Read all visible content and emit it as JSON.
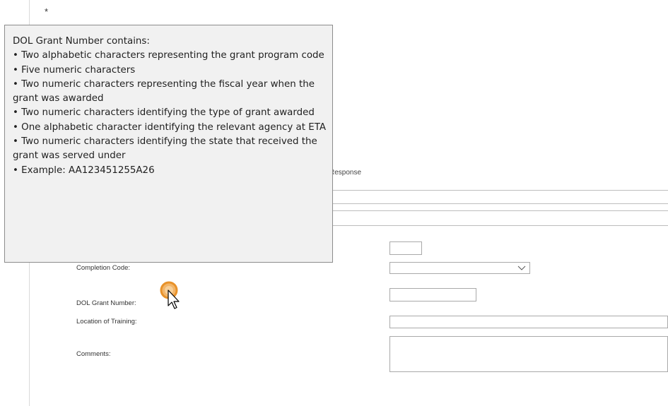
{
  "form": {
    "required_marker": "*",
    "response_label": "Response",
    "fields": {
      "completion_code": {
        "label": "Completion Code:",
        "selected": ""
      },
      "dol_grant_number": {
        "label": "DOL Grant Number:",
        "value": ""
      },
      "location_of_training": {
        "label": "Location of Training:",
        "value": ""
      },
      "comments": {
        "label": "Comments:",
        "value": ""
      },
      "unlabeled_short_input": {
        "value": ""
      }
    }
  },
  "tooltip": {
    "title": "DOL Grant Number contains:",
    "items": [
      "• Two alphabetic characters representing the grant program code",
      "• Five numeric characters",
      "• Two numeric characters representing the fiscal year when the grant was awarded",
      "• Two numeric characters identifying the type of grant awarded",
      "• One alphabetic character identifying the relevant agency at ETA",
      "• Two numeric characters identifying the state that received the grant was served under",
      "• Example: AA123451255A26"
    ]
  },
  "icons": {
    "cursor": "pointer-arrow-icon",
    "highlight": "click-highlight-icon",
    "dropdown": "chevron-down-icon"
  },
  "colors": {
    "tooltip_background": "#f1f1f1",
    "tooltip_border": "#8c8c8c",
    "click_highlight": "#e8922a",
    "input_border": "#a9a9a9"
  }
}
